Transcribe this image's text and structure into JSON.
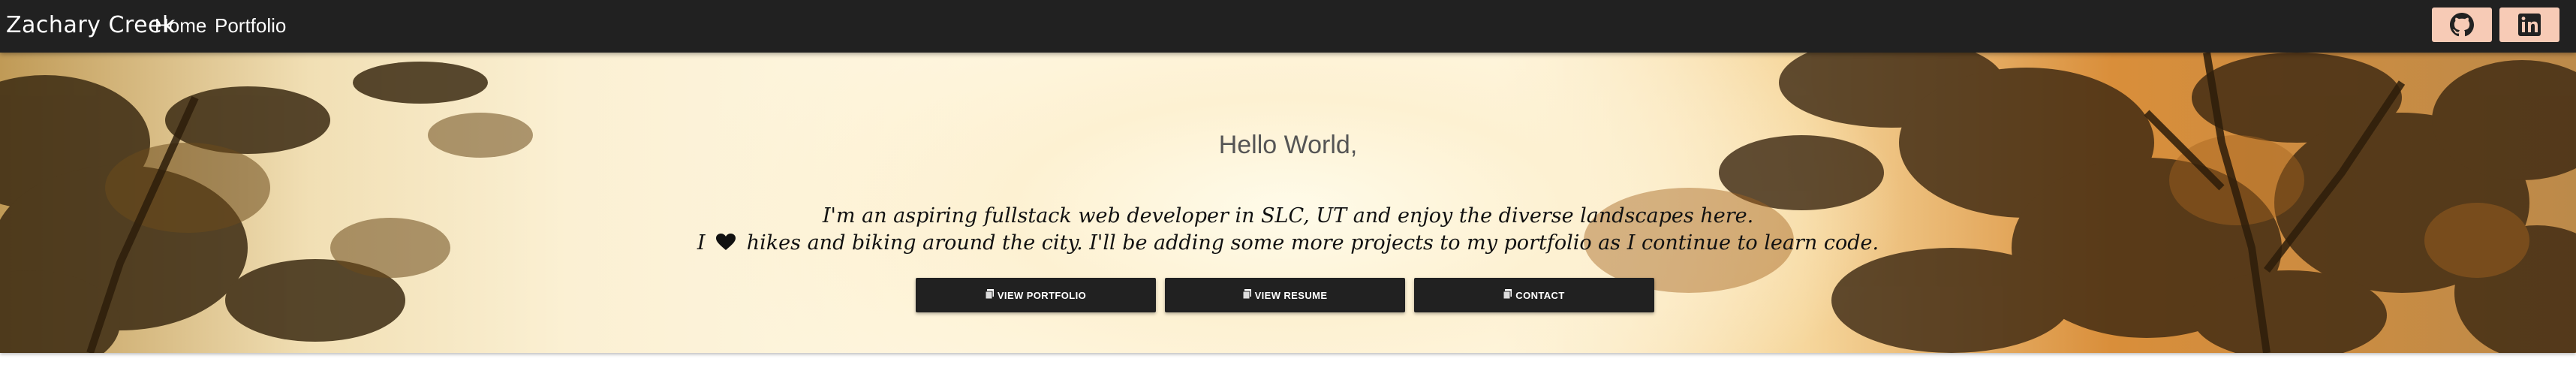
{
  "navbar": {
    "brand": "Zachary Creek",
    "links": [
      "Home",
      "Portfolio"
    ],
    "social": [
      {
        "icon": "github-icon"
      },
      {
        "icon": "linkedin-icon"
      }
    ],
    "social_button_color": "#f7cbb6",
    "background": "#212121"
  },
  "hero": {
    "greeting": "Hello World,",
    "line1": "I'm an aspiring fullstack web developer in SLC, UT and enjoy the diverse landscapes here.",
    "line2_start": "I",
    "line2_icon": "heart-icon",
    "line2_end": "hikes and biking around the city. I'll be adding some more projects to my portfolio as I continue to learn code.",
    "buttons": [
      {
        "label": "VIEW PORTFOLIO",
        "icon": "file-icon"
      },
      {
        "label": "VIEW RESUME",
        "icon": "file-icon"
      },
      {
        "label": "CONTACT",
        "icon": "file-icon"
      }
    ]
  }
}
